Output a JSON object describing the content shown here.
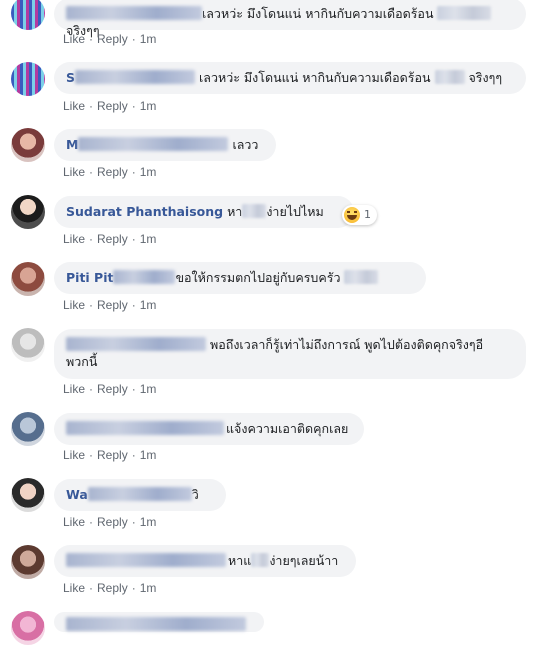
{
  "actions": {
    "like": "Like",
    "reply": "Reply",
    "separator": "·"
  },
  "comments": [
    {
      "text": "เลวหว่ะ มึงโดนแน่ หากินกับความเดือดร้อน",
      "text2": "จริงๆๆ",
      "time": "1m"
    },
    {
      "name_visible": "S",
      "text": "เลวหว่ะ มึงโดนแน่ หากินกับความเดือดร้อน",
      "text2": "จริงๆๆ",
      "time": "1m"
    },
    {
      "name_visible": "M",
      "text": "เลวว",
      "time": "1m"
    },
    {
      "name_visible": "Sudarat Phanthaisong",
      "text": "หา",
      "text2": "ง่ายไปไหม",
      "reaction_count": "1",
      "time": "1m"
    },
    {
      "name_visible": "Piti Pit",
      "text": "ขอให้กรรมตกไปอยู่กับครบครัว",
      "time": "1m"
    },
    {
      "text": "พอถึงเวลาก็รู้เท่าไม่ถึงการณ์ พูดไปต้องติดคุกจริงๆอี",
      "text_line2": "พวกนี้",
      "time": "1m"
    },
    {
      "text": "แจ้งความเอาติดคุกเลย",
      "time": "1m"
    },
    {
      "name_visible": "Wa",
      "text": "วิ",
      "time": "1m"
    },
    {
      "text": "หาแ",
      "text2": "ง่ายๆเลยน้าา",
      "time": "1m"
    }
  ],
  "colors": {
    "name": "#385898",
    "bubble": "#f2f3f5",
    "action": "#606770",
    "text": "#1c1e21"
  }
}
